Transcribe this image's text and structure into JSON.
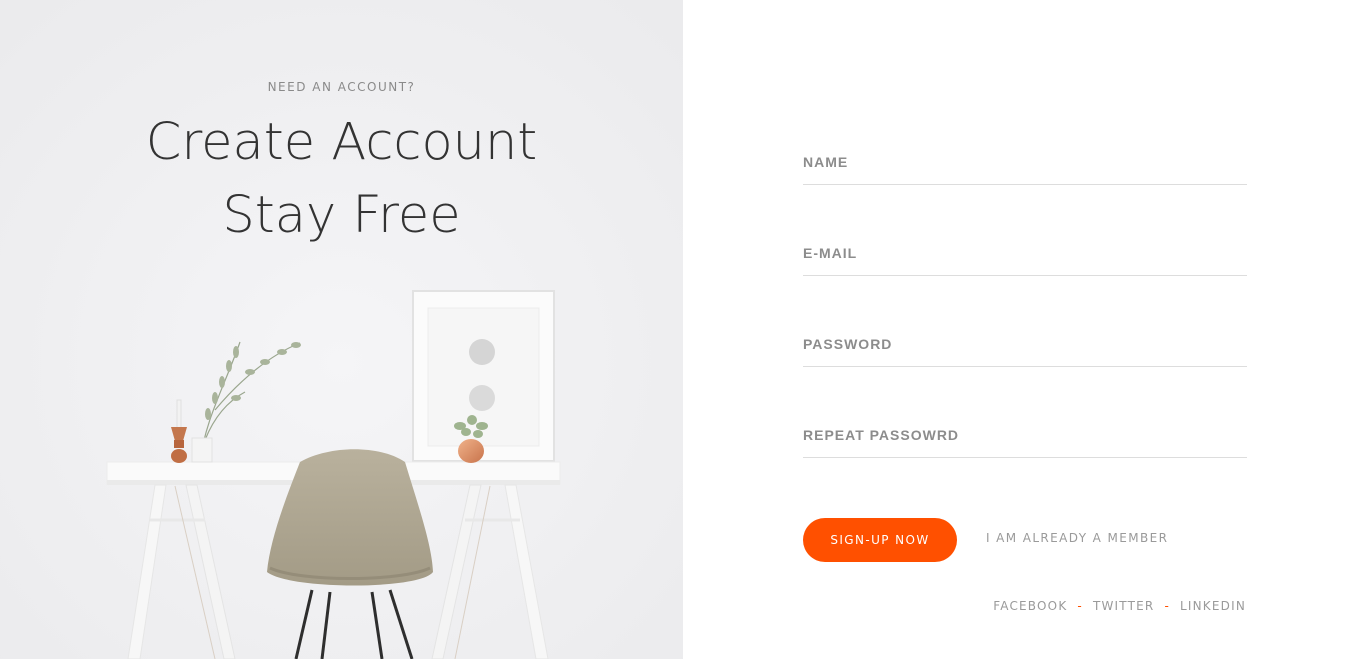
{
  "hero": {
    "kicker": "NEED AN ACCOUNT?",
    "headline_line1": "Create Account",
    "headline_line2": "Stay Free"
  },
  "form": {
    "name_placeholder": "NAME",
    "email_placeholder": "E-MAIL",
    "password_placeholder": "PASSWORD",
    "repeat_password_placeholder": "REPEAT PASSOWRD",
    "signup_label": "SIGN-UP NOW",
    "member_link_label": "I AM ALREADY A MEMBER"
  },
  "social": {
    "facebook": "FACEBOOK",
    "twitter": "TWITTER",
    "linkedin": "LINKEDIN",
    "separator": "-"
  },
  "colors": {
    "accent": "#ff5000",
    "left_background": "#efeff1",
    "label_gray": "#8c8c8c",
    "headline": "#333333"
  }
}
